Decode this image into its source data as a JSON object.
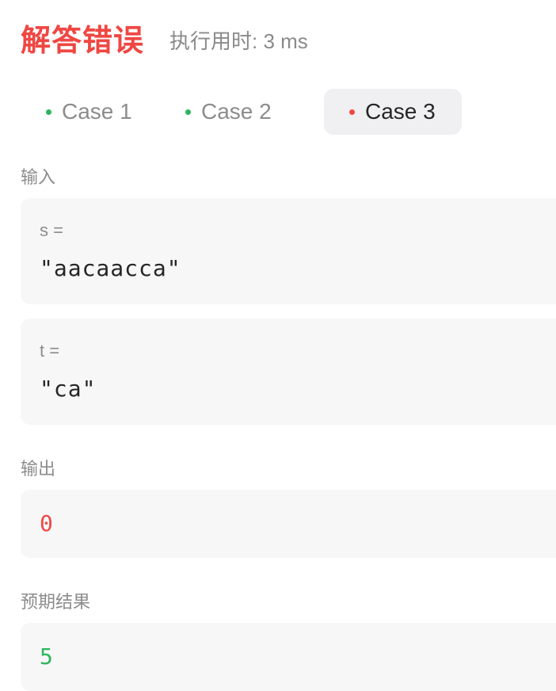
{
  "header": {
    "status": "解答错误",
    "status_color": "#ef4743",
    "runtime": "执行用时: 3 ms"
  },
  "tabs": [
    {
      "label": "Case 1",
      "status_color": "#2db55d",
      "active": false
    },
    {
      "label": "Case 2",
      "status_color": "#2db55d",
      "active": false
    },
    {
      "label": "Case 3",
      "status_color": "#ef4743",
      "active": true
    }
  ],
  "input": {
    "label": "输入",
    "params": [
      {
        "name": "s =",
        "value": "\"aacaacca\""
      },
      {
        "name": "t =",
        "value": "\"ca\""
      }
    ]
  },
  "output": {
    "label": "输出",
    "value": "0",
    "color": "#ef4743"
  },
  "expected": {
    "label": "预期结果",
    "value": "5",
    "color": "#2db55d"
  }
}
